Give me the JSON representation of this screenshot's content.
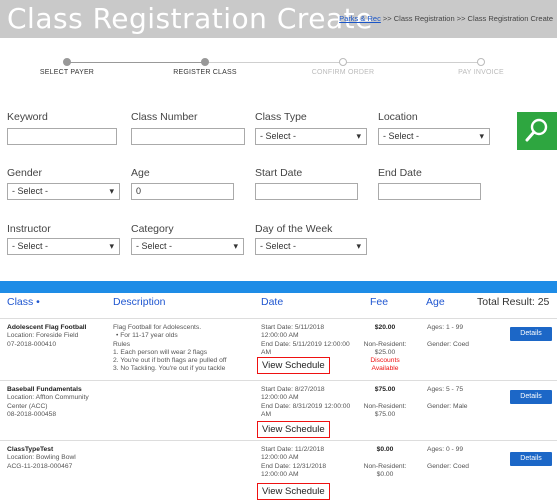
{
  "header": {
    "title": "Class Registration Create",
    "breadcrumb_link": "Parks & Rec",
    "breadcrumb_rest": " >> Class Registration >> Class Registration Create"
  },
  "steps": [
    {
      "label": "SELECT PAYER",
      "done": true
    },
    {
      "label": "REGISTER CLASS",
      "done": true
    },
    {
      "label": "CONFIRM ORDER",
      "done": false
    },
    {
      "label": "PAY INVOICE",
      "done": false
    }
  ],
  "filters": {
    "keyword": {
      "label": "Keyword",
      "value": ""
    },
    "class_number": {
      "label": "Class Number",
      "value": ""
    },
    "class_type": {
      "label": "Class Type",
      "value": "- Select -"
    },
    "location": {
      "label": "Location",
      "value": "- Select -"
    },
    "gender": {
      "label": "Gender",
      "value": "- Select -"
    },
    "age": {
      "label": "Age",
      "value": "0"
    },
    "start_date": {
      "label": "Start Date",
      "value": ""
    },
    "end_date": {
      "label": "End Date",
      "value": ""
    },
    "instructor": {
      "label": "Instructor",
      "value": "- Select -"
    },
    "category": {
      "label": "Category",
      "value": "- Select -"
    },
    "day_of_week": {
      "label": "Day of the Week",
      "value": "- Select -"
    }
  },
  "colors": {
    "search_button": "#2ea640",
    "header_bar": "#1e8ce6",
    "link": "#1f56d0",
    "highlight": "#e11111"
  },
  "table": {
    "headers": {
      "class": "Class •",
      "description": "Description",
      "date": "Date",
      "fee": "Fee",
      "age": "Age",
      "total": "Total Result: 25"
    },
    "rows": [
      {
        "name": "Adolescent Flag Football",
        "location": "Location: Foreside Field",
        "code": "07-2018-000410",
        "desc": [
          "Flag Football for Adolescents.",
          "•   For 11-17 year olds",
          "Rules",
          "1. Each person will wear 2 flags",
          "2. You're out if both flags are pulled off",
          "3. No Tackling. You're out if you tackle"
        ],
        "start": "Start Date: 5/11/2018",
        "start_time": "12:00:00 AM",
        "end": "End Date: 5/11/2019 12:00:00",
        "end_time": "AM",
        "schedule": "View Schedule",
        "fee": "$20.00",
        "nonres_label": "Non-Resident:",
        "nonres_fee": "$25.00",
        "discount1": "Discounts",
        "discount2": "Available",
        "ages": "Ages: 1 - 99",
        "gender": "Gender: Coed",
        "details": "Details"
      },
      {
        "name": "Baseball Fundamentals",
        "location": "Location: Affton Community",
        "location2": "Center (ACC)",
        "code": "08-2018-000458",
        "start": "Start Date: 8/27/2018",
        "start_time": "12:00:00 AM",
        "end": "End Date: 8/31/2019 12:00:00",
        "end_time": "AM",
        "schedule": "View Schedule",
        "fee": "$75.00",
        "nonres_label": "Non-Resident:",
        "nonres_fee": "$75.00",
        "ages": "Ages: 5 - 75",
        "gender": "Gender: Male",
        "details": "Details"
      },
      {
        "name": "ClassTypeTest",
        "location": "Location: Bowling Bowl",
        "code": "ACG-11-2018-000467",
        "start": "Start Date: 11/2/2018",
        "start_time": "12:00:00 AM",
        "end": "End Date: 12/31/2018",
        "end_time": "12:00:00 AM",
        "schedule": "View Schedule",
        "fee": "$0.00",
        "nonres_label": "Non-Resident:",
        "nonres_fee": "$0.00",
        "ages": "Ages: 0 - 99",
        "gender": "Gender: Coed",
        "details": "Details"
      }
    ]
  }
}
